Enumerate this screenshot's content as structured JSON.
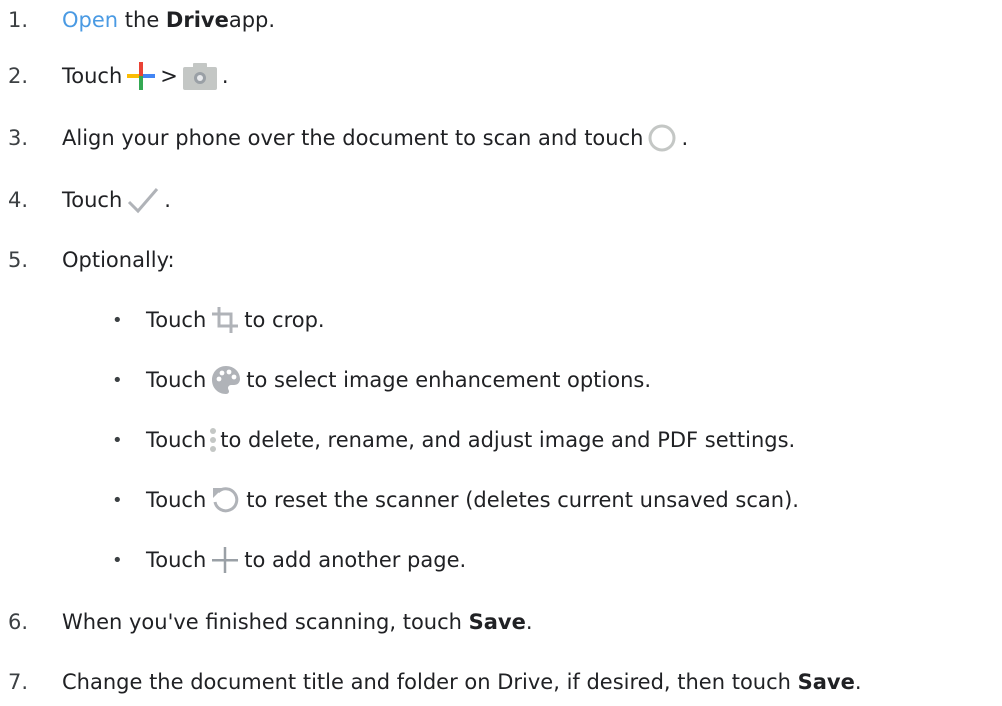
{
  "steps": [
    {
      "num": "1.",
      "link": "Open",
      "mid": " the ",
      "bold": "Drive",
      "end": " app."
    },
    {
      "num": "2.",
      "pre": "Touch",
      "sep": ">",
      "end": "."
    },
    {
      "num": "3.",
      "pre": "Align your phone over the document to scan and touch",
      "end": "."
    },
    {
      "num": "4.",
      "pre": "Touch",
      "end": "."
    },
    {
      "num": "5.",
      "pre": "Optionally:"
    },
    {
      "num": "6.",
      "pre": "When you've finished scanning, touch ",
      "bold": "Save",
      "end": "."
    },
    {
      "num": "7.",
      "pre": "Change the document title and folder on Drive, if desired, then touch ",
      "bold": "Save",
      "end": "."
    }
  ],
  "optional": [
    {
      "bullet": "•",
      "pre": "Touch",
      "icon": "crop-icon",
      "post": "to crop."
    },
    {
      "bullet": "•",
      "pre": "Touch",
      "icon": "palette-icon",
      "post": "to select image enhancement options."
    },
    {
      "bullet": "•",
      "pre": "Touch",
      "icon": "more-vert-icon",
      "post": "to delete, rename, and adjust image and PDF settings."
    },
    {
      "bullet": "•",
      "pre": "Touch",
      "icon": "reset-icon",
      "post": "to reset the scanner (deletes current unsaved scan)."
    },
    {
      "bullet": "•",
      "pre": "Touch",
      "icon": "add-page-icon",
      "post": "to add another page."
    }
  ],
  "colors": {
    "link": "#4a9ae3",
    "text": "#202124",
    "plus_yellow": "#fbbc04",
    "plus_red": "#ea4335",
    "plus_green": "#34a853",
    "plus_blue": "#4285f4",
    "icon_gray": "#9aa0a6"
  }
}
